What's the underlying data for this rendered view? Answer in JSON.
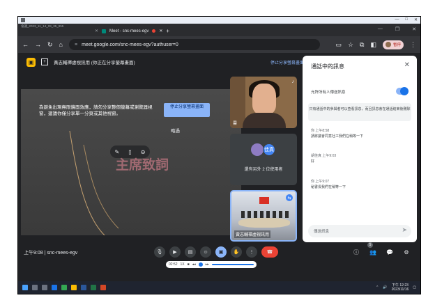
{
  "window": {
    "doc_title": "會議_2023_11_14_09_35_955",
    "controls": [
      "—",
      "□",
      "✕"
    ]
  },
  "browser": {
    "tab_label": "Meet - snc-mees-egv",
    "address": "meet.google.com/snc-mees-egv?authuser=0",
    "address_prefix": "≡",
    "pause_label": "暫停",
    "new_tab": "+"
  },
  "meet": {
    "present_label": "黃志輔禪虛視訊用 (你正在分享螢幕畫面)",
    "stop_presenting": "停止分享螢幕畫面",
    "warning": "為避免出現無限鏡面效應，請勿分享整個螢幕或瀏覽器視窗，建議你僅分享單一分頁或其他視窗。",
    "stop_share_button": "停止分享螢幕畫面",
    "skip": "略過",
    "slide_title": "主席致詞",
    "participants": {
      "tile1_name": "雲",
      "tile2_count": "還有另外 2 位使用者",
      "tile2_avatar1": "",
      "tile2_avatar2": "佳真",
      "tile3_name": "黃志輔禪虛視訊用",
      "tile3_badge": "⇆"
    },
    "meeting_code": "上午9:08 | snc-mees-egv"
  },
  "chat": {
    "title": "通話中的訊息",
    "allow_label": "允許所有人傳送訊息",
    "notice": "只有通話中的參與者可以查看訊息，而且訊息會在通話結束後刪除",
    "messages": [
      {
        "sender": "你",
        "time": "上午8:58",
        "text": "請將議會同意社工我們在稍等一下"
      },
      {
        "sender": "胡佳真",
        "time": "上午9:03",
        "text": "好"
      },
      {
        "sender": "你",
        "time": "上午9:07",
        "text": "秘書長我們在稍等一下"
      }
    ],
    "input_placeholder": "傳送訊息"
  },
  "player": {
    "time": "02:52",
    "speed": "1X"
  },
  "taskbar": {
    "clock_time": "下午 12:23",
    "clock_date": "2023/11/16"
  },
  "colors": {
    "meet_bg": "#202124",
    "accent_blue": "#8ab4f8",
    "end_call_red": "#ea4335"
  }
}
